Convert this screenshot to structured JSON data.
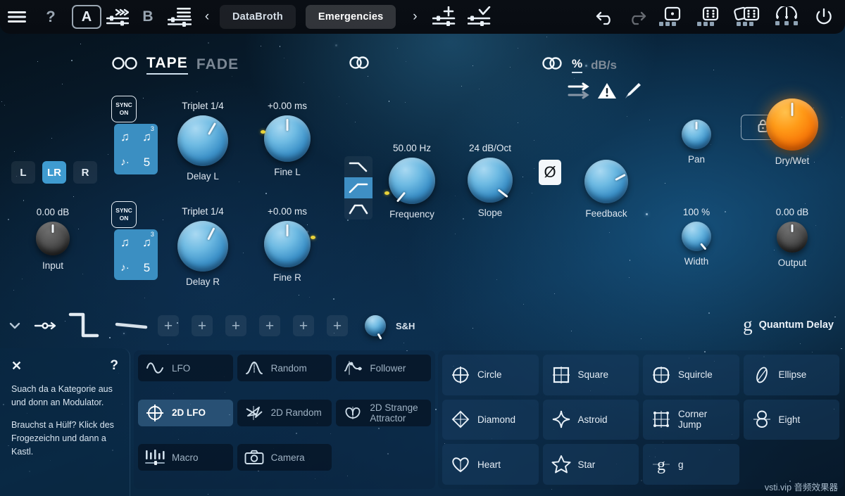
{
  "topbar": {
    "menu_icon": "hamburger-icon",
    "help_icon": "question-mark-icon",
    "ab_a": "A",
    "ab_b": "B",
    "copy_icon": "sliders-arrow-icon",
    "list_icon": "sliders-list-icon",
    "prev_arrow": "‹",
    "next_arrow": "›",
    "preset_left": "DataBroth",
    "preset_right": "Emergencies",
    "add_preset_icon": "sliders-plus-icon",
    "save_preset_icon": "sliders-check-icon",
    "undo_icon": "undo-arrow-icon",
    "redo_icon": "redo-arrow-icon",
    "dice1_icon": "dice-one-icon",
    "dice2_icon": "dice-six-icon",
    "dice3_icon": "double-dice-icon",
    "spread_icon": "spread-random-icon",
    "power_icon": "power-icon"
  },
  "mode_header": {
    "link_icon": "two-circles-unlinked-icon",
    "mode_tape": "TAPE",
    "mode_fade": "FADE",
    "active_mode": "TAPE",
    "stereo_link_icon": "two-circles-linked-icon"
  },
  "unit_header": {
    "link_icon": "two-circles-linked-icon",
    "unit_percent": "%",
    "unit_dbs": "dB/s",
    "active_unit": "%",
    "arrows_icon": "double-arrow-icon",
    "warning_icon": "warning-triangle-icon",
    "knife_icon": "knife-icon"
  },
  "channel_select": {
    "options": [
      "L",
      "LR",
      "R"
    ],
    "selected": "LR"
  },
  "sync": {
    "label_line1": "SYNC",
    "label_line2": "ON",
    "divisions": {
      "note": "♫",
      "triplet": "♫",
      "triplet_sup": "3",
      "dotted": "♪·",
      "quintuplet": "5"
    }
  },
  "knobs": {
    "input": {
      "value": "0.00 dB",
      "label": "Input",
      "angle": 0,
      "style": "dark",
      "size": 48
    },
    "delay_l": {
      "value": "Triplet 1/4",
      "label": "Delay L",
      "angle": 30,
      "style": "blue",
      "size": 72
    },
    "fine_l": {
      "value": "+0.00 ms",
      "label": "Fine L",
      "angle": 0,
      "style": "blue",
      "size": 60,
      "mod": true
    },
    "delay_r": {
      "value": "Triplet 1/4",
      "label": "Delay R",
      "angle": 27,
      "style": "blue",
      "size": 72
    },
    "fine_r": {
      "value": "+0.00 ms",
      "label": "Fine R",
      "angle": 0,
      "style": "blue",
      "size": 60,
      "mod": true
    },
    "frequency": {
      "value": "50.00 Hz",
      "label": "Frequency",
      "angle": -140,
      "style": "blue",
      "size": 66,
      "mod": true
    },
    "slope": {
      "value": "24 dB/Oct",
      "label": "Slope",
      "angle": 128,
      "style": "blue",
      "size": 64
    },
    "feedback": {
      "value": "",
      "label": "Feedback",
      "angle": 62,
      "style": "blue",
      "size": 62
    },
    "pan": {
      "value": "",
      "label": "Pan",
      "angle": 0,
      "style": "blue",
      "size": 42
    },
    "drywet": {
      "value": "",
      "label": "Dry/Wet",
      "angle": 0,
      "style": "orange",
      "size": 74
    },
    "width": {
      "value": "100 %",
      "label": "Width",
      "angle": 140,
      "style": "blue",
      "size": 42
    },
    "output": {
      "value": "0.00 dB",
      "label": "Output",
      "angle": 0,
      "style": "dark",
      "size": 44
    }
  },
  "filter": {
    "types": [
      "lowpass-icon",
      "highpass-icon",
      "bandpass-icon"
    ],
    "selected_index": 1,
    "phase_label": "Ø"
  },
  "lock": {
    "icon": "lock-icon"
  },
  "modstrip": {
    "chevron_icon": "chevron-down-icon",
    "route_icon": "modulation-route-icon",
    "wave_step_icon": "step-wave-icon",
    "wave_flat_icon": "flat-line-icon",
    "slot_count": 6,
    "slot_icon": "plus-icon",
    "active_mod_label": "S&H"
  },
  "brand": {
    "logo": "g",
    "name": "Quantum Delay"
  },
  "help": {
    "close_icon": "close-x-icon",
    "question_icon": "question-mark-icon",
    "paragraph1": "Suach da a Kategorie aus und donn an Modulator.",
    "paragraph2": "Brauchst a Hülf? Klick des Frogezeichn und dann a Kastl."
  },
  "categories": [
    {
      "label": "LFO",
      "icon": "sine-wave-icon",
      "selected": false
    },
    {
      "label": "Random",
      "icon": "bell-curve-icon",
      "selected": false
    },
    {
      "label": "Follower",
      "icon": "envelope-follower-icon",
      "selected": false
    },
    {
      "label": "2D LFO",
      "icon": "crosshair-circle-icon",
      "selected": true
    },
    {
      "label": "2D Random",
      "icon": "scribble-icon",
      "selected": false
    },
    {
      "label": "2D Strange Attractor",
      "icon": "attractor-icon",
      "selected": false
    },
    {
      "label": "Macro",
      "icon": "faders-icon",
      "selected": false
    },
    {
      "label": "Camera",
      "icon": "camera-icon",
      "selected": false
    }
  ],
  "shapes": [
    {
      "label": "Circle",
      "icon": "circle-shape-icon"
    },
    {
      "label": "Square",
      "icon": "square-shape-icon"
    },
    {
      "label": "Squircle",
      "icon": "squircle-shape-icon"
    },
    {
      "label": "Ellipse",
      "icon": "ellipse-shape-icon"
    },
    {
      "label": "Diamond",
      "icon": "diamond-shape-icon"
    },
    {
      "label": "Astroid",
      "icon": "astroid-shape-icon"
    },
    {
      "label": "Corner Jump",
      "icon": "corner-jump-shape-icon"
    },
    {
      "label": "Eight",
      "icon": "eight-shape-icon"
    },
    {
      "label": "Heart",
      "icon": "heart-shape-icon"
    },
    {
      "label": "Star",
      "icon": "star-shape-icon"
    },
    {
      "label": "g",
      "icon": "g-shape-icon"
    }
  ],
  "watermark": "vsti.vip 音频效果器"
}
